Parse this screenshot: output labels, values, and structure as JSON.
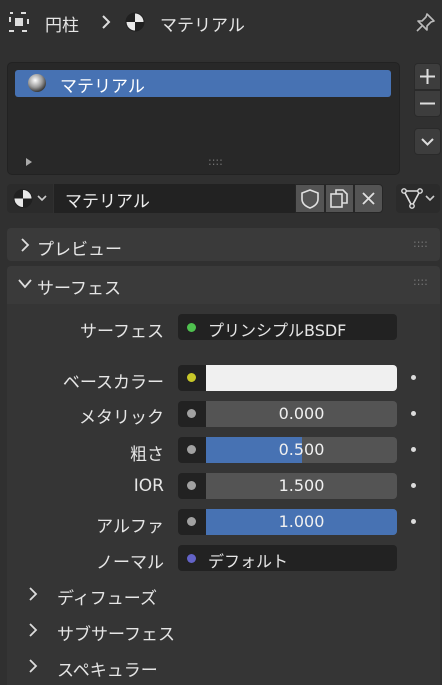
{
  "header": {
    "object_name": "円柱",
    "material_name": "マテリアル"
  },
  "slots": {
    "items": [
      "マテリアル"
    ]
  },
  "datablock": {
    "name": "マテリアル"
  },
  "panels": {
    "preview": "プレビュー",
    "surface": "サーフェス"
  },
  "surface": {
    "shader_label": "サーフェス",
    "shader_value": "プリンシプルBSDF",
    "shader_color": "#4fc14f",
    "rows": [
      {
        "label": "ベースカラー",
        "socket_color": "#c7c729",
        "type": "color",
        "swatch": "#f0f0f0"
      },
      {
        "label": "メタリック",
        "socket_color": "#a1a1a1",
        "type": "slider",
        "value": "0.000",
        "fraction": 0.0
      },
      {
        "label": "粗さ",
        "socket_color": "#a1a1a1",
        "type": "slider",
        "value": "0.500",
        "fraction": 0.5
      },
      {
        "label": "IOR",
        "socket_color": "#a1a1a1",
        "type": "slider",
        "value": "1.500",
        "fraction": 0.0
      },
      {
        "label": "アルファ",
        "socket_color": "#a1a1a1",
        "type": "slider",
        "value": "1.000",
        "fraction": 1.0
      }
    ],
    "normal": {
      "label": "ノーマル",
      "value": "デフォルト",
      "socket_color": "#6363c7"
    },
    "subpanels": [
      "ディフューズ",
      "サブサーフェス",
      "スペキュラー"
    ]
  },
  "colors": {
    "accent": "#4772b3",
    "background": "#303030"
  }
}
